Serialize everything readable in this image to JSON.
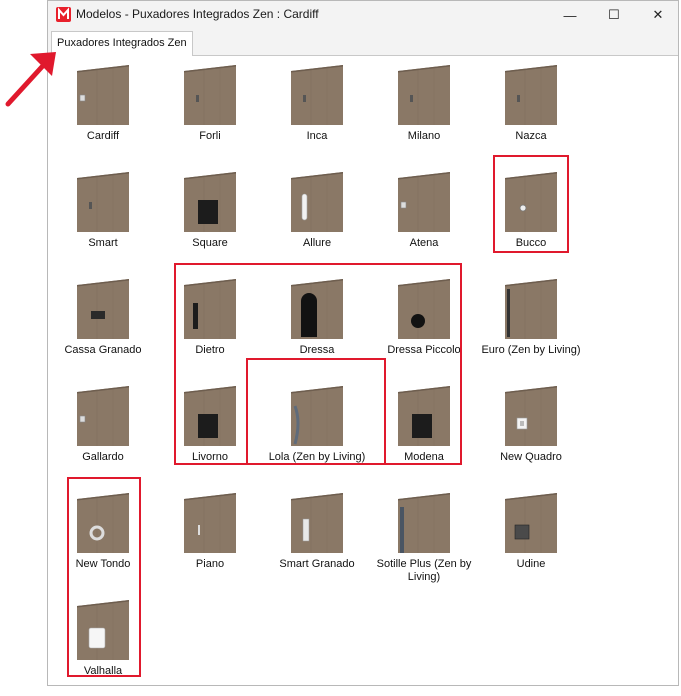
{
  "window": {
    "title": "Modelos - Puxadores Integrados Zen : Cardiff",
    "minimize_glyph": "—",
    "maximize_glyph": "☐",
    "close_glyph": "✕"
  },
  "tab": {
    "label": "Puxadores Integrados Zen"
  },
  "models": [
    {
      "name": "Cardiff"
    },
    {
      "name": "Forli"
    },
    {
      "name": "Inca"
    },
    {
      "name": "Milano"
    },
    {
      "name": "Nazca"
    },
    {
      "name": "Smart"
    },
    {
      "name": "Square"
    },
    {
      "name": "Allure"
    },
    {
      "name": "Atena"
    },
    {
      "name": "Bucco"
    },
    {
      "name": "Cassa Granado"
    },
    {
      "name": "Dietro"
    },
    {
      "name": "Dressa"
    },
    {
      "name": "Dressa Piccolo"
    },
    {
      "name": "Euro (Zen by Living)"
    },
    {
      "name": "Gallardo"
    },
    {
      "name": "Livorno"
    },
    {
      "name": "Lola (Zen by Living)"
    },
    {
      "name": "Modena"
    },
    {
      "name": "New Quadro"
    },
    {
      "name": "New Tondo"
    },
    {
      "name": "Piano"
    },
    {
      "name": "Smart Granado"
    },
    {
      "name": "Sotille Plus (Zen by Living)"
    },
    {
      "name": "Udine"
    },
    {
      "name": "Valhalla"
    }
  ],
  "colors": {
    "door_wood": "#8a7866",
    "door_edge": "#6e5e4f",
    "highlight": "#e0192d"
  }
}
